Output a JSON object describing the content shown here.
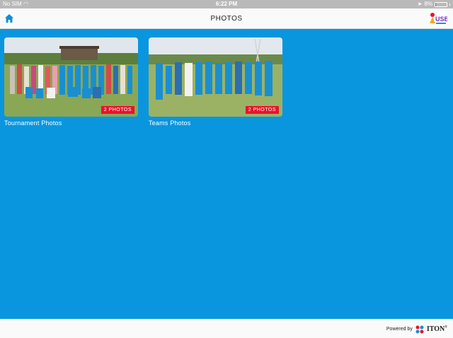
{
  "status_bar": {
    "carrier": "No SIM",
    "time": "6:22 PM",
    "battery_percent": "8%",
    "battery_level": 0.08,
    "battery_color": "#e23a3a"
  },
  "nav": {
    "title": "PHOTOS",
    "home_icon": "home-icon",
    "logo_icon": "app-logo"
  },
  "albums": [
    {
      "label": "Tournament Photos",
      "badge": "2 PHOTOS"
    },
    {
      "label": "Teams Photos",
      "badge": "2 PHOTOS"
    }
  ],
  "footer": {
    "powered_by": "Powered by",
    "brand": "ITON",
    "trademark": "®"
  },
  "colors": {
    "background": "#0996de",
    "badge": "#e8132b",
    "nav_bg": "#fafafa"
  }
}
